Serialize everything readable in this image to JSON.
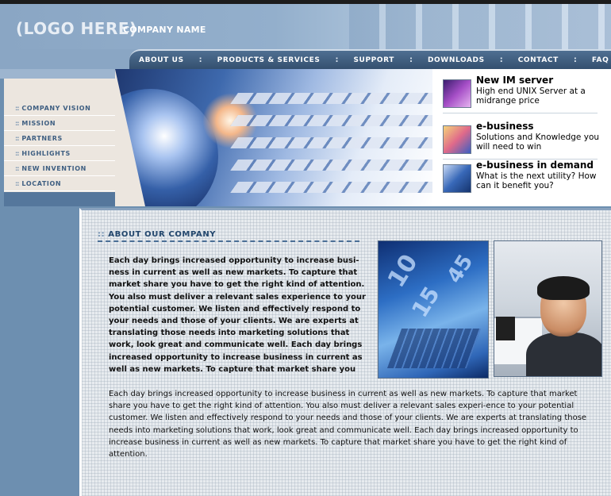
{
  "header": {
    "logo": "(LOGO HERE)",
    "company_name": "COMPANY NAME"
  },
  "nav": {
    "items": [
      {
        "label": "ABOUT US"
      },
      {
        "label": "PRODUCTS & SERVICES"
      },
      {
        "label": "SUPPORT"
      },
      {
        "label": "DOWNLOADS"
      },
      {
        "label": "CONTACT"
      },
      {
        "label": "FAQ"
      }
    ],
    "separator": ":"
  },
  "sidebar": {
    "bullet": "::",
    "items": [
      {
        "label": "COMPANY VISION"
      },
      {
        "label": "MISSION"
      },
      {
        "label": "PARTNERS"
      },
      {
        "label": "HIGHLIGHTS"
      },
      {
        "label": "NEW INVENTION"
      },
      {
        "label": "LOCATION"
      }
    ]
  },
  "promos": [
    {
      "title": "New IM    server",
      "desc": "High end UNIX Server at a midrange price"
    },
    {
      "title": "e-business",
      "desc": "Solutions and Knowledge you will need to win"
    },
    {
      "title": "e-business in demand",
      "desc": "What is the next utility? How can it benefit you?"
    }
  ],
  "about": {
    "prefix": "::",
    "title": "ABOUT OUR COMPANY",
    "bold_text": "Each day brings increased opportunity to increase busi-ness in current as well as new markets. To capture that market share you have to get the right kind of attention. You also must deliver a relevant sales experience to your potential customer. We listen and effectively respond to your needs and those of your clients. We are experts at translating those needs into marketing solutions that work, look great and communicate well. Each day brings increased opportunity to increase business in current as well as new markets. To capture that market share you",
    "normal_text": "Each day brings increased opportunity to increase business in current as well as new markets. To capture that market share you have to get the right kind of attention. You also must deliver a relevant sales experi-ence to your potential customer. We listen and effectively respond to your needs and those of your clients. We are experts at translating those needs into marketing solutions that work, look great and communicate well. Each day brings increased opportunity to increase business in current as well as new markets. To capture that market share you have to get the right kind of attention."
  },
  "colors": {
    "nav_bg": "#34506f",
    "side_menu_bg": "#ece6df",
    "side_label": "#3f5f82",
    "section_title": "#23476d"
  }
}
